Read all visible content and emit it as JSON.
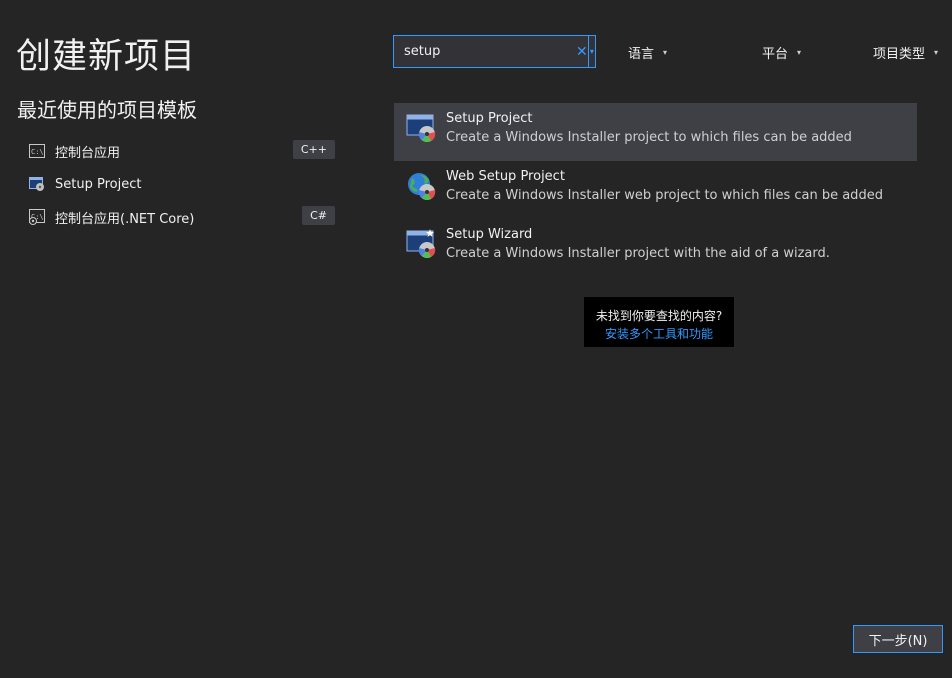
{
  "page_title": "创建新项目",
  "recent": {
    "heading": "最近使用的项目模板",
    "items": [
      {
        "label": "控制台应用",
        "badge": "C++",
        "icon": "console-icon"
      },
      {
        "label": "Setup Project",
        "badge": "",
        "icon": "setup-project-icon"
      },
      {
        "label": "控制台应用(.NET Core)",
        "badge": "C#",
        "icon": "console-netcore-icon"
      }
    ]
  },
  "search": {
    "value": "setup",
    "clear_glyph": "✕",
    "dropdown_glyph": "▾"
  },
  "filters": {
    "language": "语言",
    "platform": "平台",
    "project_type": "项目类型",
    "caret": "▾"
  },
  "results": [
    {
      "title": "Setup Project",
      "description": "Create a Windows Installer project to which files can be added",
      "icon": "setup-project-icon",
      "selected": true
    },
    {
      "title": "Web Setup Project",
      "description": "Create a Windows Installer web project to which files can be added",
      "icon": "web-setup-globe-icon",
      "selected": false
    },
    {
      "title": "Setup Wizard",
      "description": "Create a Windows Installer project with the aid of a wizard.",
      "icon": "setup-wizard-icon",
      "selected": false
    }
  ],
  "not_found": {
    "question": "未找到你要查找的内容?",
    "link": "安装多个工具和功能"
  },
  "next_button": "下一步(N)",
  "colors": {
    "background": "#252526",
    "accent": "#3399ff",
    "selected_row": "#3f3f46",
    "badge_bg": "#3f3f46"
  }
}
